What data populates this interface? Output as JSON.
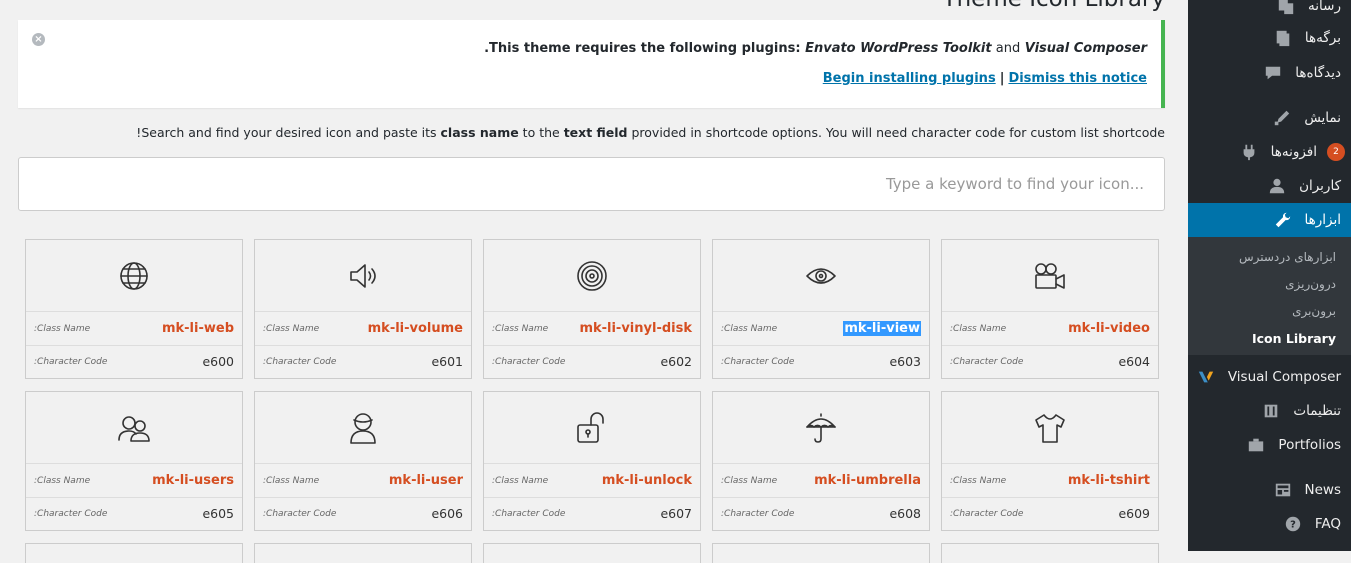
{
  "page": {
    "title": "Theme Icon Library"
  },
  "notice": {
    "prefix": "This theme requires the following plugins:",
    "plugin1": "Envato WordPress Toolkit",
    "and": "and",
    "plugin2": "Visual Composer",
    "trail": ".",
    "install_link": "Begin installing plugins",
    "separator": "|",
    "dismiss_link": "Dismiss this notice",
    "dismiss_icon": "close-icon"
  },
  "help": {
    "t1": "Search and find your desired icon and paste its ",
    "b1": "class name",
    "t2": " to the ",
    "b2": "text field",
    "t3": " provided in shortcode options. You will need character code for custom list shortcode",
    "t4": "!"
  },
  "search": {
    "placeholder": "Type a keyword to find your icon..."
  },
  "labels": {
    "class_name": ":Class Name",
    "character_code": ":Character Code"
  },
  "icons": [
    {
      "icon": "globe-icon",
      "class": "mk-li-web",
      "code": "e600"
    },
    {
      "icon": "volume-icon",
      "class": "mk-li-volume",
      "code": "e601"
    },
    {
      "icon": "vinyl-disk-icon",
      "class": "mk-li-vinyl-disk",
      "code": "e602"
    },
    {
      "icon": "eye-icon",
      "class": "mk-li-view",
      "code": "e603",
      "selected": true
    },
    {
      "icon": "video-camera-icon",
      "class": "mk-li-video",
      "code": "e604"
    },
    {
      "icon": "users-icon",
      "class": "mk-li-users",
      "code": "e605"
    },
    {
      "icon": "user-icon",
      "class": "mk-li-user",
      "code": "e606"
    },
    {
      "icon": "unlock-icon",
      "class": "mk-li-unlock",
      "code": "e607"
    },
    {
      "icon": "umbrella-icon",
      "class": "mk-li-umbrella",
      "code": "e608"
    },
    {
      "icon": "tshirt-icon",
      "class": "mk-li-tshirt",
      "code": "e609"
    }
  ],
  "sidebar": {
    "items": [
      {
        "label": "رسانه",
        "icon": "media-icon"
      },
      {
        "label": "برگه‌ها",
        "icon": "pages-icon"
      },
      {
        "label": "دیدگاه‌ها",
        "icon": "comments-icon"
      },
      {
        "label": "نمایش",
        "icon": "appearance-icon"
      },
      {
        "label": "افزونه‌ها",
        "icon": "plugins-icon",
        "badge": "2"
      },
      {
        "label": "کاربران",
        "icon": "users-icon"
      },
      {
        "label": "ابزارها",
        "icon": "tools-icon",
        "active": true
      },
      {
        "label": "Visual Composer",
        "icon": "visual-composer-icon"
      },
      {
        "label": "تنظیمات",
        "icon": "settings-icon"
      },
      {
        "label": "Portfolios",
        "icon": "portfolio-icon"
      },
      {
        "label": "News",
        "icon": "news-icon"
      },
      {
        "label": "FAQ",
        "icon": "faq-icon"
      }
    ],
    "submenu": [
      {
        "label": "ابزارهای دردسترس"
      },
      {
        "label": "درون‌ریزی"
      },
      {
        "label": "برون‌بری"
      },
      {
        "label": "Icon Library",
        "current": true
      }
    ]
  },
  "colors": {
    "accent": "#0073aa",
    "class_name": "#d54e21",
    "notice_border": "#46b450",
    "sidebar_bg": "#23282d"
  }
}
